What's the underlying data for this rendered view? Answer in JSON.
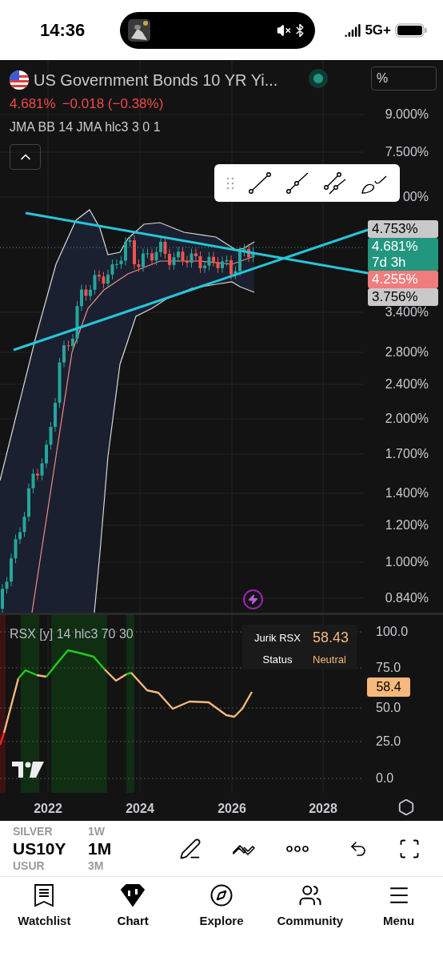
{
  "status_bar": {
    "time": "14:36",
    "network": "5G+"
  },
  "chart_header": {
    "title": "US Government Bonds 10 YR Yi...",
    "price": "4.681%",
    "change": "−0.018 (−0.38%)",
    "indicator": "JMA BB 14 JMA hlc3 3 0 1",
    "scale_button": "%"
  },
  "price_axis": [
    "9.000%",
    "7.500%",
    "00%",
    "3.400%",
    "2.800%",
    "2.400%",
    "2.000%",
    "1.700%",
    "1.400%",
    "1.200%",
    "1.000%",
    "0.840%"
  ],
  "price_labels": [
    {
      "text": "4.753%",
      "kind": "band"
    },
    {
      "text": "4.681%",
      "sub": "7d 3h",
      "kind": "last"
    },
    {
      "text": "4.255%",
      "kind": "low"
    },
    {
      "text": "3.756%",
      "kind": "band"
    }
  ],
  "rsx": {
    "title": "RSX [y] 14 hlc3 70 30",
    "table": [
      {
        "label": "Jurik RSX",
        "value": "58.43"
      },
      {
        "label": "Status",
        "value": "Neutral"
      }
    ],
    "value_badge": "58.4",
    "axis": [
      "100.0",
      "75.0",
      "50.0",
      "25.0",
      "0.0"
    ]
  },
  "time_axis": [
    "2022",
    "2024",
    "2026",
    "2028"
  ],
  "picker": {
    "symbols": [
      {
        "text": "SILVER",
        "selected": false
      },
      {
        "text": "US10Y",
        "selected": true
      },
      {
        "text": "USUR",
        "selected": false
      }
    ],
    "intervals": [
      {
        "text": "1W",
        "selected": false
      },
      {
        "text": "1M",
        "selected": true
      },
      {
        "text": "3M",
        "selected": false
      }
    ]
  },
  "tabs": [
    {
      "label": "Watchlist",
      "selected": false
    },
    {
      "label": "Chart",
      "selected": true
    },
    {
      "label": "Explore",
      "selected": false
    },
    {
      "label": "Community",
      "selected": false
    },
    {
      "label": "Menu",
      "selected": false
    }
  ]
}
